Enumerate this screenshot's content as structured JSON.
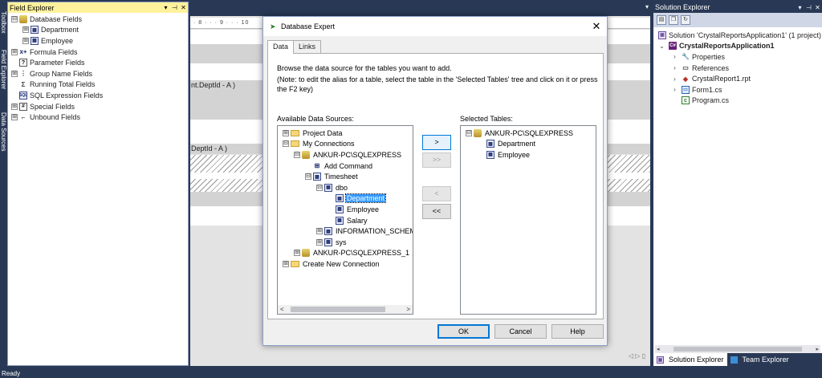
{
  "left_vbar": {
    "tabs": [
      "Toolbox",
      "Field Explorer",
      "Data Sources"
    ]
  },
  "field_explorer": {
    "title": "Field Explorer",
    "header_buttons": [
      "▾",
      "⊣",
      "✕"
    ],
    "items": [
      {
        "label": "Database Fields",
        "expander": "⊟",
        "icon": "database-icon"
      },
      {
        "label": "Department",
        "expander": "⊞",
        "icon": "table-icon"
      },
      {
        "label": "Employee",
        "expander": "⊞",
        "icon": "table-icon"
      },
      {
        "label": "Formula Fields",
        "expander": "⊞",
        "icon": "formula-icon"
      },
      {
        "label": "Parameter Fields",
        "expander": "",
        "icon": "parameter-icon"
      },
      {
        "label": "Group Name Fields",
        "expander": "⊞",
        "icon": "group-icon"
      },
      {
        "label": "Running Total Fields",
        "expander": "",
        "icon": "running-total-icon"
      },
      {
        "label": "SQL Expression Fields",
        "expander": "",
        "icon": "sql-icon"
      },
      {
        "label": "Special Fields",
        "expander": "⊞",
        "icon": "special-icon"
      },
      {
        "label": "Unbound Fields",
        "expander": "⊞",
        "icon": "unbound-icon"
      }
    ]
  },
  "designer": {
    "ruler": "· 8 · · · 9 · · · 10",
    "band1_label": "nt.DeptId - A )",
    "band2_label": "DeptId - A )"
  },
  "dialog": {
    "title": "Database Expert",
    "close_glyph": "✕",
    "tabs": [
      {
        "label": "Data",
        "active": true
      },
      {
        "label": "Links",
        "active": false
      }
    ],
    "instruction_1": "Browse the data source for the tables you want to add.",
    "instruction_2": "(Note: to edit the alias for a table, select the table in the 'Selected Tables' tree and click on it or press the F2 key)",
    "available_label": "Available Data Sources:",
    "selected_label": "Selected Tables:",
    "available_tree": [
      {
        "label": "Project Data",
        "expander": "⊞",
        "icon": "folder-icon",
        "indent": 0
      },
      {
        "label": "My Connections",
        "expander": "⊟",
        "icon": "folder-icon",
        "indent": 0
      },
      {
        "label": "ANKUR-PC\\SQLEXPRESS",
        "expander": "⊟",
        "icon": "server-icon",
        "indent": 1
      },
      {
        "label": "Add Command",
        "expander": "",
        "icon": "command-icon",
        "indent": 2
      },
      {
        "label": "Timesheet",
        "expander": "⊟",
        "icon": "database-icon",
        "indent": 2
      },
      {
        "label": "dbo",
        "expander": "⊟",
        "icon": "schema-icon",
        "indent": 3
      },
      {
        "label": "Department",
        "expander": "",
        "icon": "table-icon",
        "indent": 4,
        "selected": true
      },
      {
        "label": "Employee",
        "expander": "",
        "icon": "table-icon",
        "indent": 4
      },
      {
        "label": "Salary",
        "expander": "",
        "icon": "table-icon",
        "indent": 4
      },
      {
        "label": "INFORMATION_SCHEM",
        "expander": "⊞",
        "icon": "schema-icon",
        "indent": 3
      },
      {
        "label": "sys",
        "expander": "⊞",
        "icon": "schema-icon",
        "indent": 3
      },
      {
        "label": "ANKUR-PC\\SQLEXPRESS_1",
        "expander": "⊞",
        "icon": "server-icon",
        "indent": 1
      },
      {
        "label": "Create New Connection",
        "expander": "⊞",
        "icon": "folder-icon",
        "indent": 0
      }
    ],
    "selected_tree": [
      {
        "label": "ANKUR-PC\\SQLEXPRESS",
        "expander": "⊟",
        "icon": "server-icon",
        "indent": 0
      },
      {
        "label": "Department",
        "expander": "",
        "icon": "table-icon",
        "indent": 1
      },
      {
        "label": "Employee",
        "expander": "",
        "icon": "table-icon",
        "indent": 1
      }
    ],
    "move_buttons": {
      "add_one": ">",
      "add_all": ">>",
      "remove_one": "<",
      "remove_all": "<<"
    },
    "scroll_left": "<",
    "scroll_right": ">",
    "ok_label": "OK",
    "cancel_label": "Cancel",
    "help_label": "Help"
  },
  "solution_explorer": {
    "title": "Solution Explorer",
    "header_buttons": [
      "▾",
      "⊣",
      "✕"
    ],
    "solution_label": "Solution 'CrystalReportsApplication1' (1 project)",
    "items": [
      {
        "label": "CrystalReportsApplication1",
        "chevron": "⌄",
        "icon": "project-icon",
        "indent": 0,
        "bold": true
      },
      {
        "label": "Properties",
        "chevron": "›",
        "icon": "properties-icon",
        "indent": 1
      },
      {
        "label": "References",
        "chevron": "›",
        "icon": "references-icon",
        "indent": 1
      },
      {
        "label": "CrystalReport1.rpt",
        "chevron": "›",
        "icon": "report-icon",
        "indent": 1
      },
      {
        "label": "Form1.cs",
        "chevron": "›",
        "icon": "form-icon",
        "indent": 1
      },
      {
        "label": "Program.cs",
        "chevron": "",
        "icon": "csharp-file-icon",
        "indent": 1
      }
    ],
    "bottom_tabs": [
      {
        "label": "Solution Explorer",
        "active": true
      },
      {
        "label": "Team Explorer",
        "active": false
      }
    ]
  },
  "status_bar": {
    "text": "Ready"
  }
}
